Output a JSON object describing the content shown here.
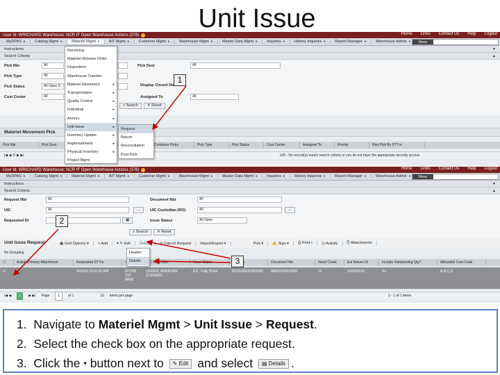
{
  "slide": {
    "title": "Unit Issue"
  },
  "topbar": {
    "user_label": "User Id: WRICHARD  Warehouse: NCR IF  Open Warehouse Actions (378)",
    "user_label2": "User Id: WRICHARD  Warehouse: NCR IF  Open Warehouse Actions (376)",
    "links": [
      "Home",
      "Links",
      "Contact Us",
      "Help",
      "Logout"
    ]
  },
  "menubar": {
    "items": [
      "MyDPAS",
      "Catalog Mgmt",
      "Materiel Mgmt",
      "AIT Mgmt",
      "Customer Mgmt",
      "Warehouse Mgmt",
      "Master Data Mgmt",
      "Inquiries",
      "History Inquiries",
      "Report Manager",
      "Warehouse Admin"
    ],
    "search_button": "Menu"
  },
  "screen1": {
    "instructions": "Instructions",
    "search_criteria": "Search Criteria",
    "fields": {
      "pick_nbr": {
        "label": "Pick Nbr",
        "value": "All"
      },
      "pick_type": {
        "label": "Pick Type",
        "value": "All"
      },
      "pick_status": {
        "label": "Pick Status",
        "value": "All Open S"
      },
      "cost_center": {
        "label": "Cost Center",
        "value": "All"
      },
      "pick_dest": {
        "label": "Pick Dest",
        "value": "All"
      },
      "display_closed": {
        "label": "Display Closed Statuses"
      },
      "assigned_to": {
        "label": "Assigned To",
        "value": "All"
      }
    },
    "search_btn": "Search",
    "reset_btn": "Reset",
    "grid_title": "Materiel Movement Pick",
    "columns": [
      "Pick Nbr",
      "Pick Dest",
      "Container Picks",
      "Pick Type",
      "Pick Status",
      "Cost Center",
      "Assigned To",
      "Priority",
      "Req Pick By DTTm"
    ],
    "pager_text": "125 - No record(s) match search criteria or you do not have the appropriate security access",
    "dropdown": [
      "Receiving",
      "Materiel Release Order",
      "Disposition",
      "Warehouse Transfer",
      "Materiel Movement",
      "Transportation",
      "Quality Control",
      "Individual",
      "Armory",
      "Unit Issue",
      "Inventory Update",
      "Replenishment",
      "Physical Inventory",
      "Project Mgmt"
    ],
    "submenu": [
      "Request",
      "Return",
      "Reconciliation",
      "Post Post"
    ]
  },
  "screen2": {
    "instructions": "Instructions",
    "search_criteria": "Search Criteria",
    "fields": {
      "request_nbr": {
        "label": "Request Nbr",
        "value": "All"
      },
      "uic": {
        "label": "UIC",
        "value": "All"
      },
      "requested_dt": {
        "label": "Requested Dt"
      },
      "document_nbr": {
        "label": "Document Nbr",
        "value": "All"
      },
      "uic_custodian": {
        "label": "UIC Custodian (RO)",
        "value": "All"
      },
      "issue_status": {
        "label": "Issue Status",
        "value": "All Open"
      }
    },
    "search_btn": "Search",
    "reset_btn": "Reset",
    "grid_title": "Unit Issue Request",
    "toolbar": [
      "Grid Options",
      "Add",
      "Edit",
      "Delete",
      "Cancel Request",
      "Import/Export",
      "Pick",
      "Sign",
      "Print",
      "Activity",
      "Attachments"
    ],
    "edit_menu": [
      "Header",
      "Details"
    ],
    "no_grouping": "No Grouping",
    "columns": [
      "Actions",
      "Primary Attachment",
      "Requested DTTm",
      "UIC",
      "UIC Custodian",
      "Issue Status",
      "Pick Nbr",
      "Document Nbr",
      "Head Count",
      "Est Return Dt",
      "Include Outstanding Qty?",
      "Allowable Cost Code"
    ],
    "row": [
      "9/20/15 10:41:41 AM",
      "NCTB5 1ST MAW",
      "LINDEN, ABRAHAM (C000000)",
      "ES - Fully Pickd",
      "NCRU00152453000",
      "MB00545453000",
      "10",
      "10/02/2015",
      "No",
      "A,B,C,D"
    ],
    "pager": {
      "page_label": "Page",
      "page": "1",
      "of": "of 1",
      "per_page": "10",
      "per_page_label": "items per page",
      "count": "1 - 1 of 1 items"
    }
  },
  "badges": [
    "1",
    "2",
    "3"
  ],
  "instructions": {
    "step1_prefix": "Navigate to ",
    "step1_a": "Materiel Mgmt",
    "step1_sep1": " > ",
    "step1_b": "Unit Issue",
    "step1_sep2": " > ",
    "step1_c": "Request",
    "step1_end": ".",
    "step2": "Select the check box on the appropriate request.",
    "step3_a": "Click the",
    "step3_b": "button next to",
    "step3_c": "and select",
    "step3_end": ".",
    "edit_btn": "Edit",
    "details_btn": "Details",
    "nums": [
      "1.",
      "2.",
      "3."
    ]
  }
}
